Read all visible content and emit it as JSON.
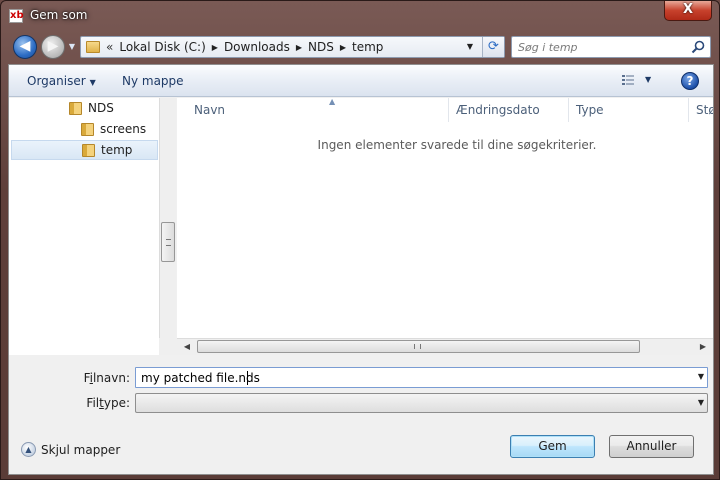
{
  "window": {
    "title": "Gem som",
    "app_icon_glyph": "xb",
    "close_glyph": "X"
  },
  "nav": {
    "back_glyph": "◀",
    "forward_glyph": "▶",
    "history_glyph": "▼"
  },
  "address": {
    "overflow": "«",
    "crumbs": [
      "Lokal Disk (C:)",
      "Downloads",
      "NDS",
      "temp"
    ]
  },
  "search": {
    "placeholder": "Søg i temp"
  },
  "toolbar": {
    "organise_label": "Organiser",
    "new_folder_label": "Ny mappe",
    "help_glyph": "?"
  },
  "tree": {
    "items": [
      {
        "label": "NDS"
      },
      {
        "label": "screens"
      },
      {
        "label": "temp",
        "selected": true
      }
    ]
  },
  "filelist": {
    "columns": [
      "Navn",
      "Ændringsdato",
      "Type",
      "Størrelse"
    ],
    "empty_message": "Ingen elementer svarede til dine søgekriterier."
  },
  "form": {
    "filename_label_prefix": "F",
    "filename_label_accel": "i",
    "filename_label_suffix": "lnavn:",
    "filename_value": "my patched file.nds",
    "filetype_label_prefix": "Fil",
    "filetype_label_accel": "t",
    "filetype_label_suffix": "ype:",
    "filetype_value": ""
  },
  "footer": {
    "hide_folders_label": "Skjul mapper",
    "save_label": "Gem",
    "cancel_label": "Annuller"
  },
  "colors": {
    "frame": "#5e3f3a",
    "close": "#c7412c",
    "accent": "#2c6cc4",
    "selection": "#d9e7f5"
  }
}
